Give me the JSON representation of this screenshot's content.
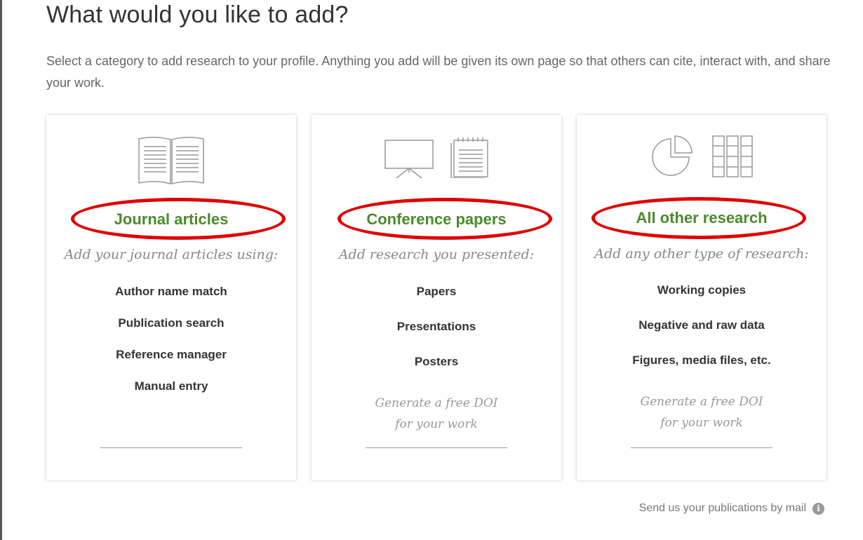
{
  "page": {
    "title": "What would you like to add?",
    "intro": "Select a category to add research to your profile. Anything you add will be given its own page so that others can cite, interact with, and share your work."
  },
  "cards": [
    {
      "title": "Journal articles",
      "subtitle": "Add your journal articles using:",
      "items": [
        "Author name match",
        "Publication search",
        "Reference manager",
        "Manual entry"
      ],
      "icons": [
        "open-book-icon"
      ]
    },
    {
      "title": "Conference papers",
      "subtitle": "Add research you presented:",
      "items": [
        "Papers",
        "Presentations",
        "Posters"
      ],
      "doi_line1": "Generate a free DOI",
      "doi_line2": "for your work",
      "icons": [
        "presentation-board-icon",
        "notepad-icon"
      ]
    },
    {
      "title": "All other research",
      "subtitle": "Add any other type of research:",
      "items": [
        "Working copies",
        "Negative and raw data",
        "Figures, media files, etc."
      ],
      "doi_line1": "Generate a free DOI",
      "doi_line2": "for your work",
      "icons": [
        "pie-chart-icon",
        "data-grid-icon"
      ]
    }
  ],
  "footer": {
    "mail_link": "Send us your publications by mail",
    "icon": "info-icon"
  },
  "colors": {
    "title_green": "#4a8a2c",
    "highlight_red": "#e00000",
    "icon_gray": "#999999"
  }
}
